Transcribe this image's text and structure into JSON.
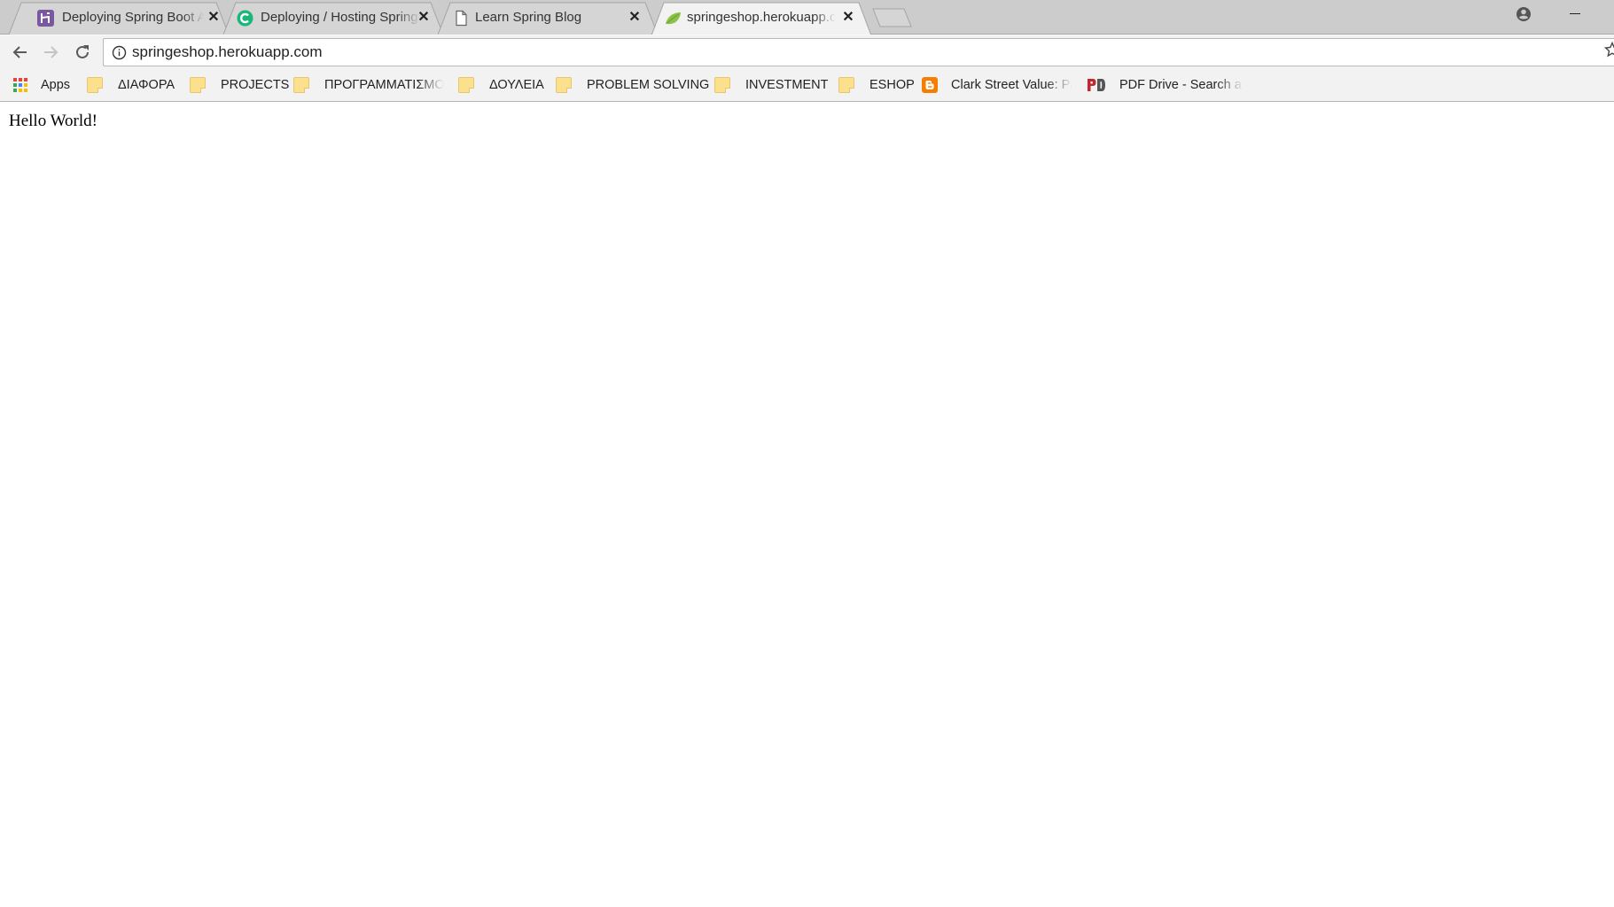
{
  "tabs": [
    {
      "title": "Deploying Spring Boot Applications to Heroku",
      "favicon": "heroku-icon",
      "active": false,
      "close_label": "✕"
    },
    {
      "title": "Deploying / Hosting Spring Boot",
      "favicon": "c-circle-icon",
      "active": false,
      "close_label": "✕"
    },
    {
      "title": "Learn Spring Blog",
      "favicon": "document-icon",
      "active": false,
      "close_label": "✕"
    },
    {
      "title": "springeshop.herokuapp.com",
      "favicon": "spring-leaf-icon",
      "active": true,
      "close_label": "✕"
    }
  ],
  "toolbar": {
    "url": "springeshop.herokuapp.com"
  },
  "bookmarks": [
    {
      "label": "Apps",
      "icon": "apps-grid-icon"
    },
    {
      "label": "ΔΙΑΦΟΡΑ",
      "icon": "folder-icon"
    },
    {
      "label": "PROJECTS",
      "icon": "folder-icon"
    },
    {
      "label": "ΠΡΟΓΡΑΜΜΑΤΙΣΜΟΣ",
      "icon": "folder-icon"
    },
    {
      "label": "ΔΟΥΛΕΙΑ",
      "icon": "folder-icon"
    },
    {
      "label": "PROBLEM SOLVING",
      "icon": "folder-icon"
    },
    {
      "label": "INVESTMENT",
      "icon": "folder-icon"
    },
    {
      "label": "ESHOP",
      "icon": "folder-icon"
    },
    {
      "label": "Clark Street Value: Pa",
      "icon": "blogger-icon"
    },
    {
      "label": "PDF Drive - Search a",
      "icon": "pdf-drive-icon"
    }
  ],
  "page": {
    "text": "Hello World!"
  },
  "colors": {
    "tabstrip_bg": "#cccccc",
    "active_tab_bg": "#f2f2f2",
    "heroku_purple": "#79589f",
    "c_green": "#1bb67a",
    "spring_green": "#8bc34a",
    "blogger_orange": "#f57d00",
    "pdf_red": "#c1272d"
  }
}
